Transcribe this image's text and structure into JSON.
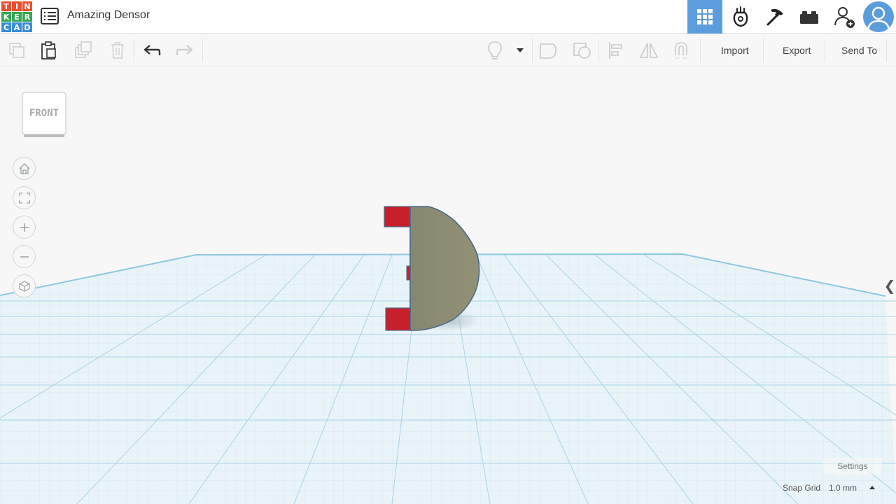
{
  "app": {
    "logo_letters": [
      "T",
      "I",
      "N",
      "K",
      "E",
      "R",
      "C",
      "A",
      "D"
    ],
    "logo_colors": [
      "#e8512e",
      "#e8512e",
      "#e8512e",
      "#34a853",
      "#34a853",
      "#34a853",
      "#3a8ed8",
      "#3a8ed8",
      "#3a8ed8"
    ],
    "design_title": "Amazing Densor"
  },
  "header": {
    "icons": [
      "grid-view-icon",
      "circuits-icon",
      "codeblocks-icon",
      "bricks-icon",
      "add-user-icon"
    ]
  },
  "toolbar": {
    "import_label": "Import",
    "export_label": "Export",
    "send_to_label": "Send To"
  },
  "viewcube": {
    "face_label": "FRONT"
  },
  "view_controls": [
    "home-view-icon",
    "fit-view-icon",
    "zoom-in-icon",
    "zoom-out-icon",
    "perspective-icon"
  ],
  "footer": {
    "settings_label": "Settings",
    "snap_grid_label": "Snap Grid",
    "snap_grid_value": "1.0 mm"
  },
  "colors": {
    "accent": "#5b9ddc",
    "shape_fill": "#8d8c73",
    "shape_outline": "#4a6a8a",
    "peg_color": "#c8202a",
    "grid_line": "#b9dbea"
  }
}
